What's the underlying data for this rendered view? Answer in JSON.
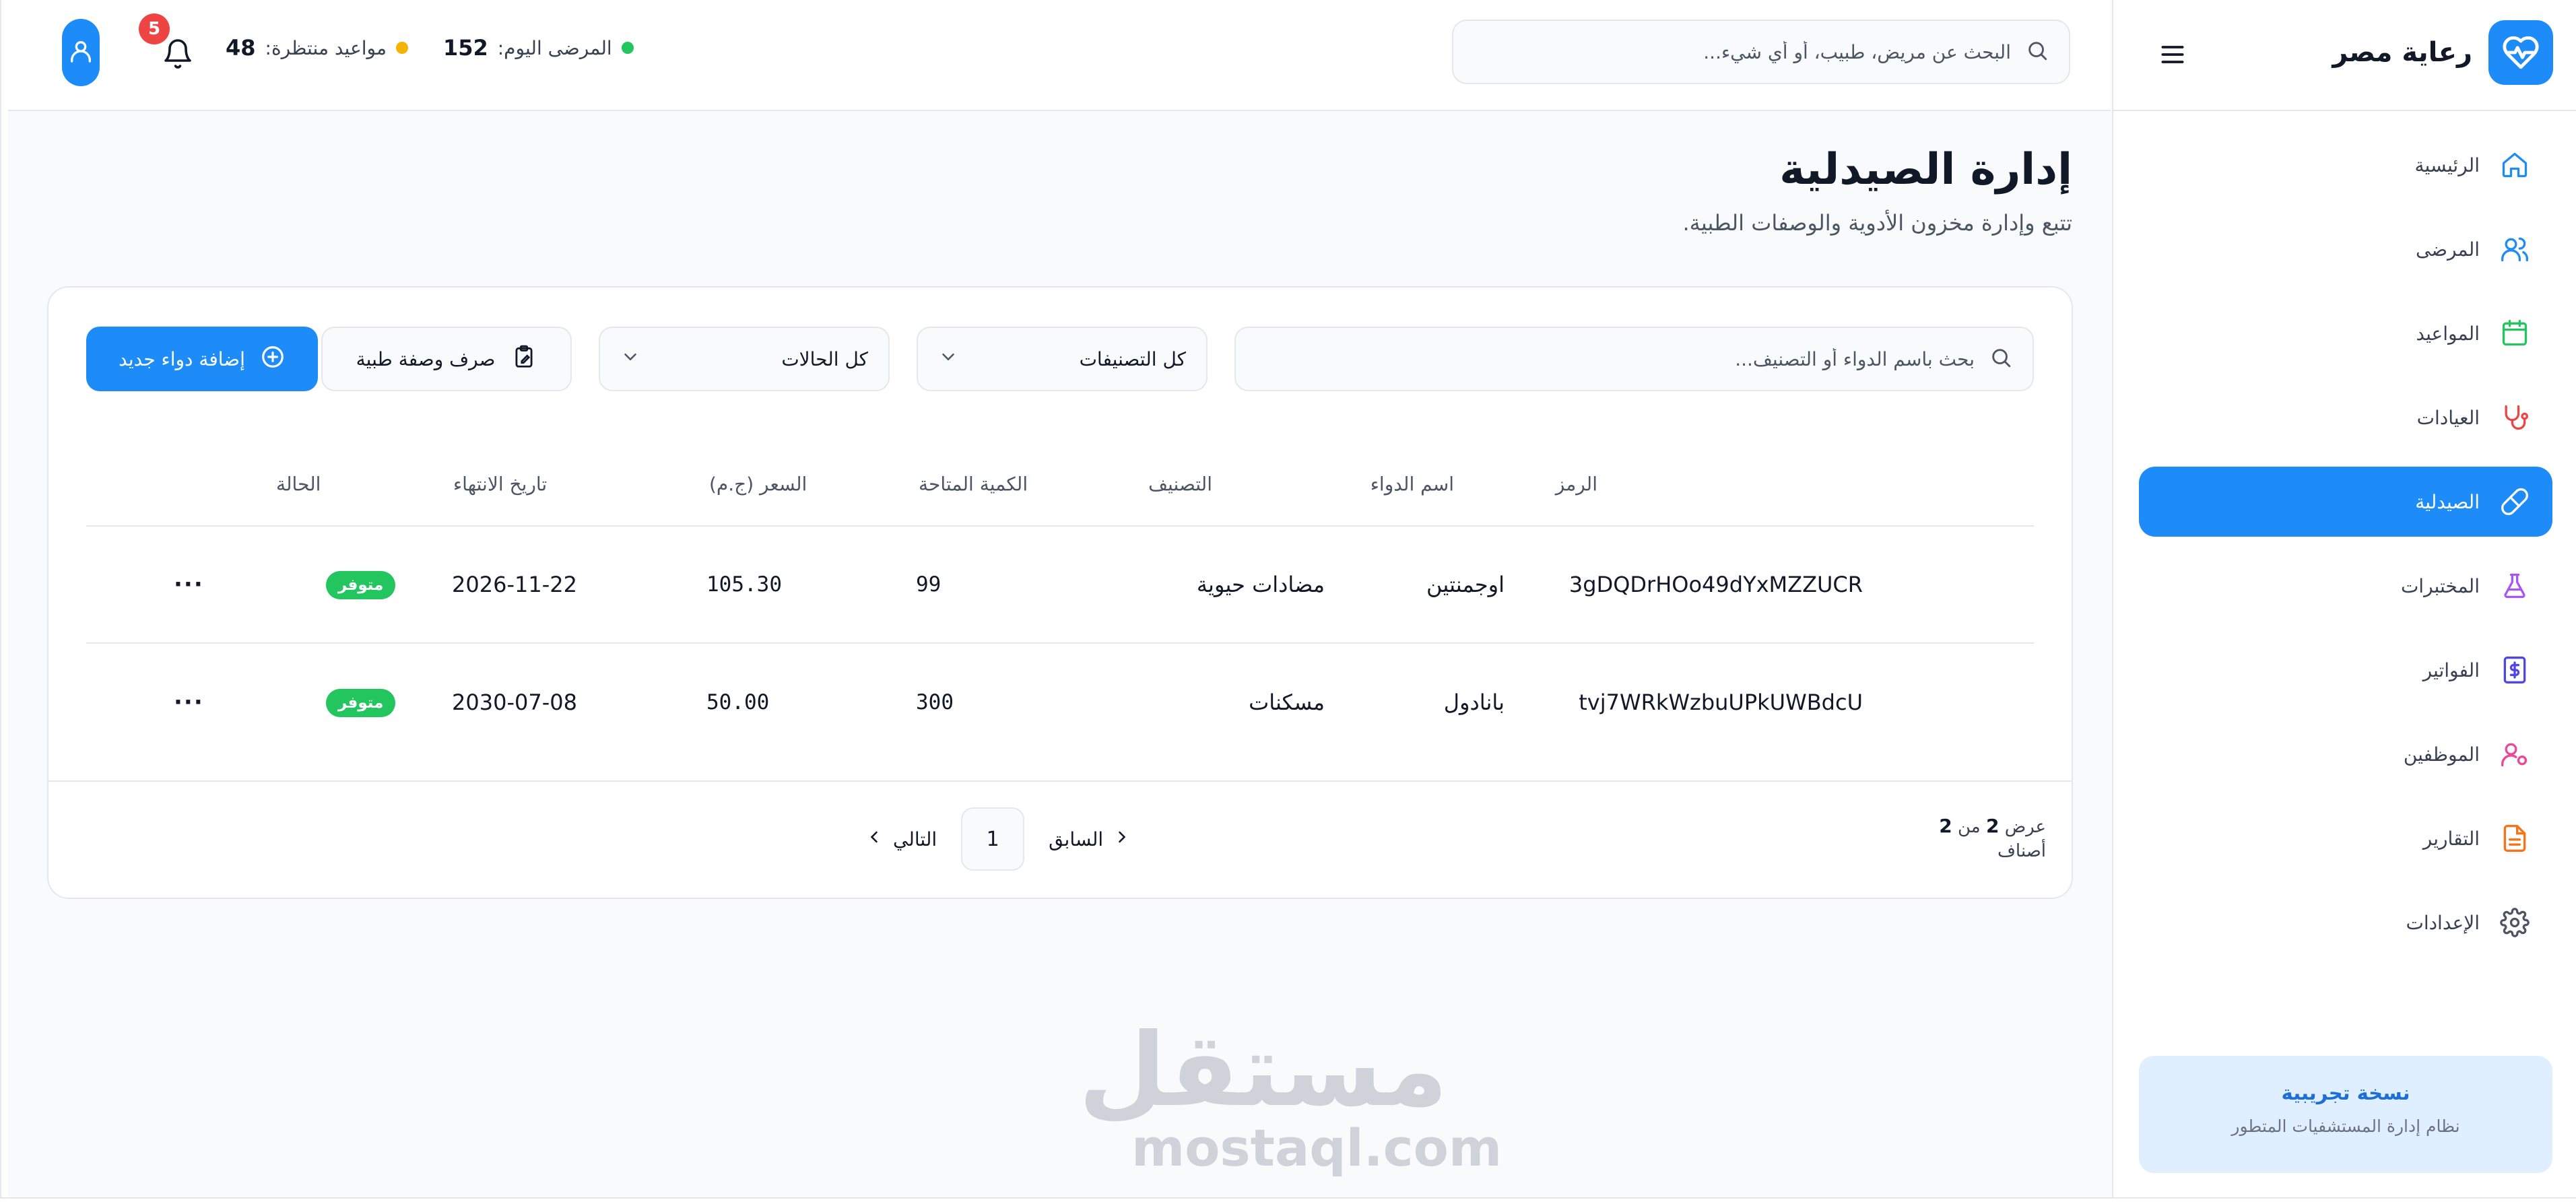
{
  "app": {
    "name": "رعاية مصر"
  },
  "sidebar": {
    "items": [
      {
        "label": "الرئيسية",
        "icon": "home-icon",
        "active": false
      },
      {
        "label": "المرضى",
        "icon": "users-icon",
        "active": false
      },
      {
        "label": "المواعيد",
        "icon": "calendar-icon",
        "active": false
      },
      {
        "label": "العيادات",
        "icon": "stethoscope-icon",
        "active": false
      },
      {
        "label": "الصيدلية",
        "icon": "pill-icon",
        "active": true
      },
      {
        "label": "المختبرات",
        "icon": "flask-icon",
        "active": false
      },
      {
        "label": "الفواتير",
        "icon": "dollar-icon",
        "active": false
      },
      {
        "label": "الموظفين",
        "icon": "user-gear-icon",
        "active": false
      },
      {
        "label": "التقارير",
        "icon": "report-icon",
        "active": false
      },
      {
        "label": "الإعدادات",
        "icon": "gear-icon",
        "active": false
      }
    ],
    "trial": {
      "title": "نسخة تجريبية",
      "subtitle": "نظام إدارة المستشفيات المتطور"
    }
  },
  "topbar": {
    "search_placeholder": "البحث عن مريض، طبيب، أو أي شيء...",
    "patients_today_label": "المرضى اليوم:",
    "patients_today_value": "152",
    "pending_label": "مواعيد منتظرة:",
    "pending_value": "48",
    "notifications_count": "5"
  },
  "page": {
    "title": "إدارة الصيدلية",
    "subtitle": "تتبع وإدارة مخزون الأدوية والوصفات الطبية."
  },
  "toolbar": {
    "search_placeholder": "بحث باسم الدواء أو التصنيف...",
    "category_select": "كل التصنيفات",
    "status_select": "كل الحالات",
    "prescription_button": "صرف وصفة طبية",
    "add_button": "إضافة دواء جديد"
  },
  "table": {
    "headers": {
      "code": "الرمز",
      "name": "اسم الدواء",
      "category": "التصنيف",
      "quantity": "الكمية المتاحة",
      "price": "السعر (ج.م)",
      "expiry": "تاريخ الانتهاء",
      "status": "الحالة"
    },
    "rows": [
      {
        "code": "3gDQDrHOo49dYxMZZUCR",
        "name": "اوجمنتين",
        "category": "مضادات حيوية",
        "quantity": "99",
        "price": "105.30",
        "expiry": "2026-11-22",
        "status": "متوفر",
        "more": "···"
      },
      {
        "code": "tvj7WRkWzbuUPkUWBdcU",
        "name": "بانادول",
        "category": "مسكنات",
        "quantity": "300",
        "price": "50.00",
        "expiry": "2030-07-08",
        "status": "متوفر",
        "more": "···"
      }
    ]
  },
  "pagination": {
    "showing_prefix": "عرض",
    "shown": "2",
    "of": "من",
    "total": "2",
    "unit": "أصناف",
    "prev": "السابق",
    "page": "1",
    "next": "التالي"
  },
  "watermark": {
    "ar": "مستقل",
    "en": "mostaql.com"
  },
  "colors": {
    "primary": "#1d8cf8",
    "success": "#22c55e",
    "danger": "#ef4444",
    "warning": "#f5b301"
  }
}
